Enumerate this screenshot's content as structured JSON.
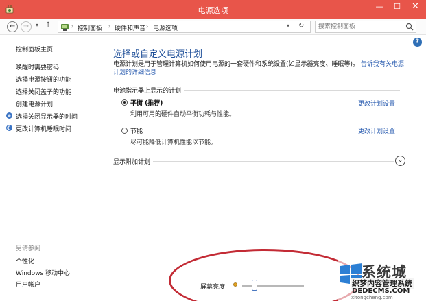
{
  "window": {
    "title": "电源选项",
    "min_glyph": "—",
    "max_glyph": "☐",
    "close_glyph": "✕"
  },
  "nav": {
    "back_glyph": "←",
    "forward_glyph": "→",
    "recent_glyph": "▾",
    "up_glyph": "↑",
    "breadcrumb": [
      "控制面板",
      "硬件和声音",
      "电源选项"
    ],
    "crumb_separator": "›",
    "refresh_glyph": "↻",
    "search_placeholder": "搜索控制面板"
  },
  "help_glyph": "?",
  "sidebar": {
    "items": [
      {
        "label": "控制面板主页"
      },
      {
        "label": "唤醒时需要密码"
      },
      {
        "label": "选择电源按钮的功能"
      },
      {
        "label": "选择关闭盖子的功能"
      },
      {
        "label": "创建电源计划"
      },
      {
        "label": "选择关闭显示器的时间"
      },
      {
        "label": "更改计算机睡眠时间"
      }
    ],
    "see_also_heading": "另请参阅",
    "see_also": [
      {
        "label": "个性化"
      },
      {
        "label": "Windows 移动中心"
      },
      {
        "label": "用户帐户"
      }
    ]
  },
  "main": {
    "title": "选择或自定义电源计划",
    "description": "电源计划是用于管理计算机如何使用电源的一套硬件和系统设置(如显示器亮度、睡眠等)。",
    "description_link": "告诉我有关电源计划的详细信息",
    "battery_section": "电池指示器上显示的计划",
    "plans": [
      {
        "name": "平衡 (推荐)",
        "desc": "利用可用的硬件自动平衡功耗与性能。",
        "selected": true,
        "link": "更改计划设置"
      },
      {
        "name": "节能",
        "desc": "尽可能降低计算机性能以节能。",
        "selected": false,
        "link": "更改计划设置"
      }
    ],
    "more_plans": "显示附加计划",
    "expand_glyph": "⌄"
  },
  "brightness": {
    "label": "屏幕亮度:",
    "value": 0.2
  },
  "watermark": {
    "logo_text": "系统城",
    "sub": "织梦内容管理系统",
    "url": "DEDECMS.COM",
    "url2": "xitongcheng.com"
  },
  "colors": {
    "titlebar": "#e8554a",
    "link": "#2a5cb0",
    "heading": "#1d4e98",
    "annotation": "#c32b35"
  }
}
